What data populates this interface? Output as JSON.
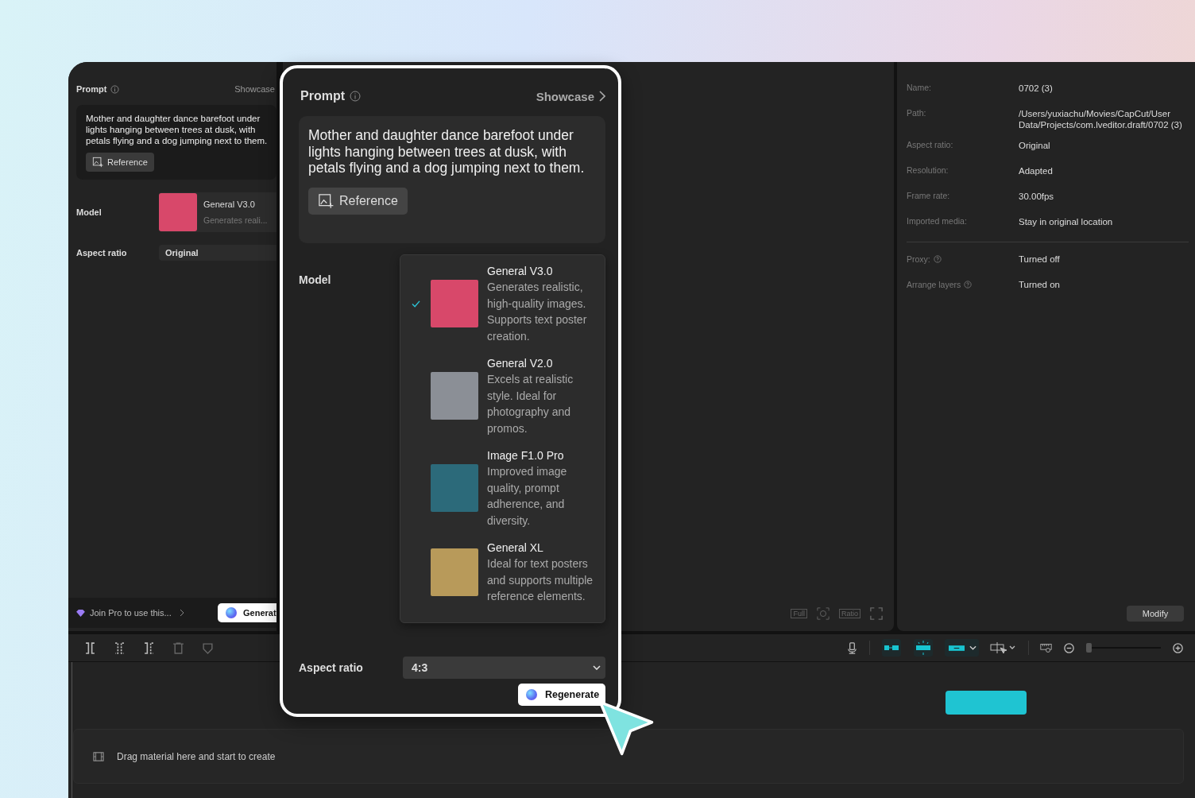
{
  "left_panel": {
    "prompt_label": "Prompt",
    "showcase": "Showcase",
    "prompt_text": "Mother and daughter dance barefoot under lights hanging between trees at dusk, with petals flying and a dog jumping next to them.",
    "reference_button": "Reference",
    "model_label": "Model",
    "model": {
      "name": "General V3.0",
      "description": "Generates reali..."
    },
    "aspect_ratio_label": "Aspect ratio",
    "aspect_ratio": "Original",
    "pro_hint": "Join Pro to use this...",
    "generate_button": "Generat"
  },
  "canvas": {
    "full_button": "Full",
    "ratio_button": "Ratio"
  },
  "project_info": {
    "rows": [
      {
        "label": "Name:",
        "value": "0702 (3)"
      },
      {
        "label": "Path:",
        "value": "/Users/yuxiachu/Movies/CapCut/User Data/Projects/com.lveditor.draft/0702 (3)"
      },
      {
        "label": "Aspect ratio:",
        "value": "Original"
      },
      {
        "label": "Resolution:",
        "value": "Adapted"
      },
      {
        "label": "Frame rate:",
        "value": "30.00fps"
      },
      {
        "label": "Imported media:",
        "value": "Stay in original location"
      }
    ],
    "settings": [
      {
        "label": "Proxy:",
        "value": "Turned off"
      },
      {
        "label": "Arrange layers",
        "value": "Turned on"
      }
    ],
    "modify_button": "Modify"
  },
  "timeline": {
    "zoom_slider": {
      "level": 0
    },
    "drop_hint": "Drag material here and start to create"
  },
  "popup": {
    "prompt_label": "Prompt",
    "showcase": "Showcase",
    "prompt_text": "Mother and daughter dance barefoot under lights hanging between trees at dusk, with petals flying and a dog jumping next to them.",
    "reference_button": "Reference",
    "model_label": "Model",
    "models": [
      {
        "name": "General V3.0",
        "description": "Generates realistic, high-quality images. Supports text poster creation.",
        "selected": true
      },
      {
        "name": "General V2.0",
        "description": "Excels at realistic style. Ideal for photography and promos.",
        "selected": false
      },
      {
        "name": "Image F1.0 Pro",
        "description": "Improved image quality, prompt adherence, and diversity.",
        "selected": false
      },
      {
        "name": "General XL",
        "description": "Ideal for text posters and supports multiple reference elements.",
        "selected": false
      }
    ],
    "aspect_ratio_label": "Aspect ratio",
    "aspect_ratio": "4:3",
    "regenerate_button": "Regenerate"
  }
}
